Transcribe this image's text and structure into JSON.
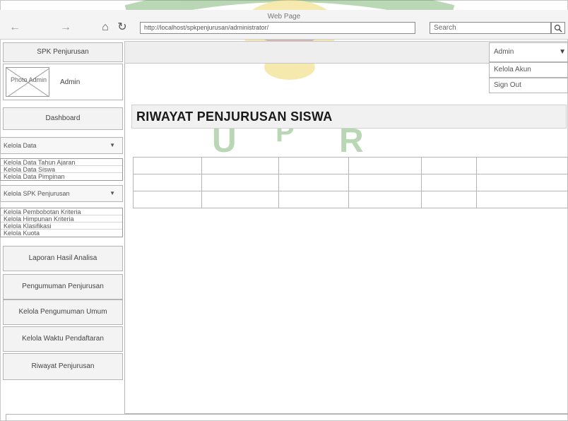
{
  "browser": {
    "window_title": "Web Page",
    "url": "http://localhost/spkpenjurusan/administrator/",
    "search_placeholder": "Search"
  },
  "header": {
    "brand": "SPK Penjurusan",
    "admin_menu": "Admin",
    "dropdown": [
      "Kelola Akun",
      "Sign Out"
    ]
  },
  "profile": {
    "photo_label": "Photo Admin",
    "name": "Admin"
  },
  "sidebar": {
    "dashboard": "Dashboard",
    "kelola_data": {
      "label": "Kelola Data",
      "items": [
        "Kelola Data Tahun Ajaran",
        "Kelola Data Siswa",
        "Kelola Data Pimpinan"
      ]
    },
    "kelola_spk": {
      "label": "Kelola SPK Penjurusan",
      "items": [
        "Kelola Pembobotan Kriteria",
        "Kelola Himpunan Kriteria",
        "Kelola Klasifikasi",
        "Kelola Kuota"
      ]
    },
    "buttons": [
      "Laporan Hasil Analisa",
      "Pengumuman Penjurusan",
      "Kelola Pengumuman Umum",
      "Kelola Waktu Pendaftaran",
      "Riwayat Penjurusan"
    ]
  },
  "main": {
    "title": "RIWAYAT PENJURUSAN SISWA"
  },
  "colors": {
    "watermark": "#3a8f2a",
    "watermark_accent": "#e8c21a"
  }
}
